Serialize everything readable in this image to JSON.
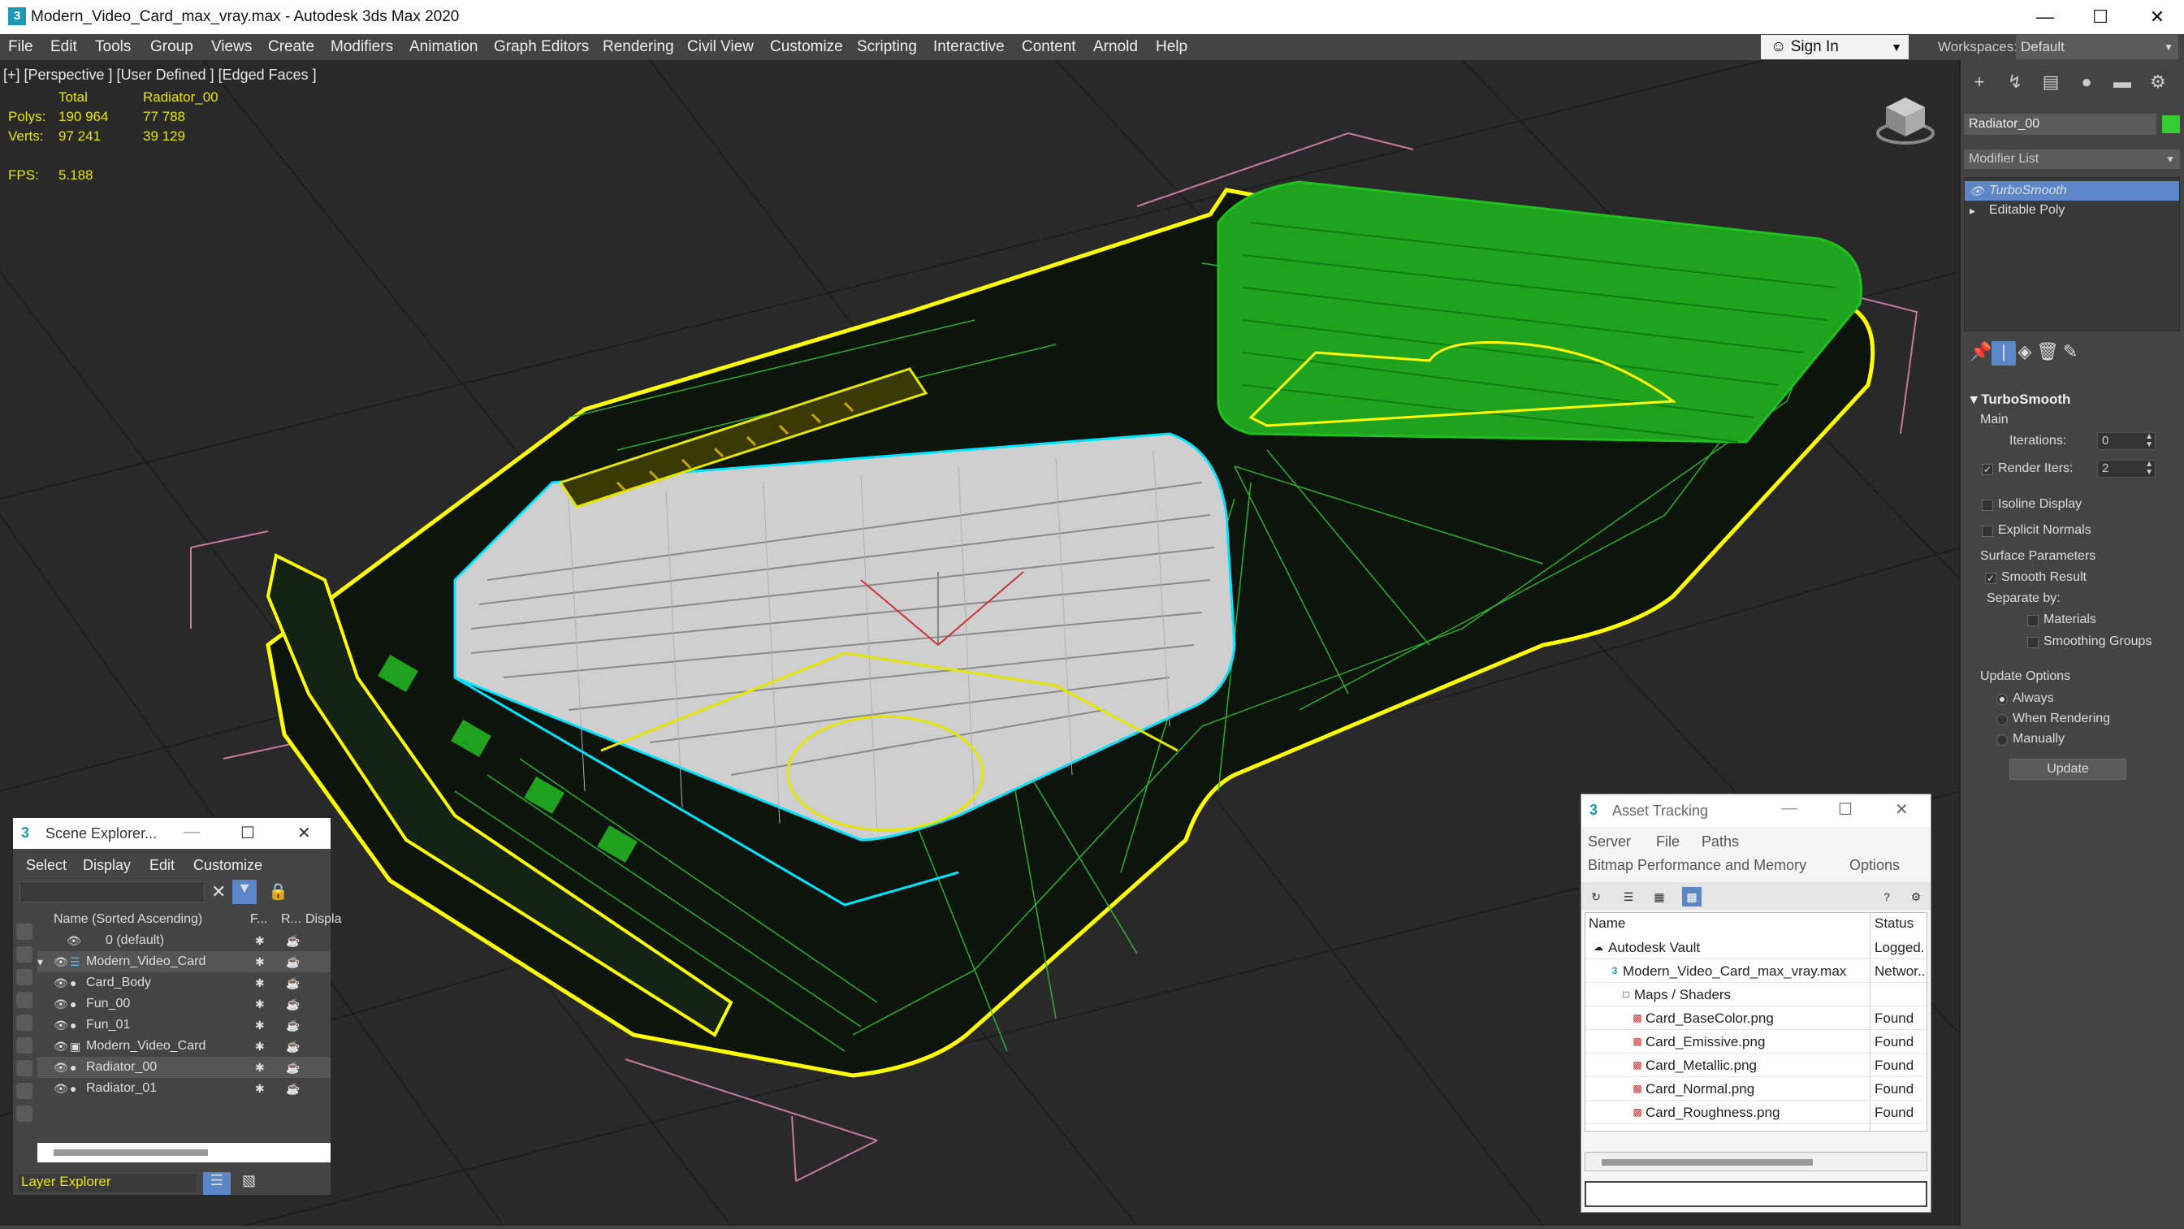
{
  "window": {
    "title": "Modern_Video_Card_max_vray.max - Autodesk 3ds Max 2020",
    "app_icon": "3"
  },
  "menu": [
    "File",
    "Edit",
    "Tools",
    "Group",
    "Views",
    "Create",
    "Modifiers",
    "Animation",
    "Graph Editors",
    "Rendering",
    "Civil View",
    "Customize",
    "Scripting",
    "Interactive",
    "Content",
    "Arnold",
    "Help"
  ],
  "account": {
    "sign_in": "Sign In"
  },
  "workspace": {
    "label": "Workspaces:",
    "value": "Default"
  },
  "viewport": {
    "label": "[+] [Perspective ] [User Defined ] [Edged Faces ]",
    "stats": {
      "header_total": "Total",
      "header_selected": "Radiator_00",
      "polys_label": "Polys:",
      "polys_total": "190 964",
      "polys_sel": "77 788",
      "verts_label": "Verts:",
      "verts_total": "97 241",
      "verts_sel": "39 129",
      "fps_label": "FPS:",
      "fps_value": "5.188"
    }
  },
  "command_panel": {
    "object_name": "Radiator_00",
    "object_color": "#33cc33",
    "modifier_list": "Modifier List",
    "stack": [
      "TurboSmooth",
      "Editable Poly"
    ],
    "rollout": {
      "title": "TurboSmooth",
      "main": "Main",
      "iterations_label": "Iterations:",
      "iterations_value": "0",
      "render_iters_label": "Render Iters:",
      "render_iters_value": "2",
      "isoline": "Isoline Display",
      "explicit_normals": "Explicit Normals",
      "surface_params": "Surface Parameters",
      "smooth_result": "Smooth Result",
      "separate_by": "Separate by:",
      "materials": "Materials",
      "smoothing_groups": "Smoothing Groups",
      "update_options": "Update Options",
      "always": "Always",
      "when_rendering": "When Rendering",
      "manually": "Manually",
      "update_button": "Update"
    }
  },
  "scene_explorer": {
    "title": "Scene Explorer...",
    "menu": [
      "Select",
      "Display",
      "Edit",
      "Customize"
    ],
    "columns": [
      "Name (Sorted Ascending)",
      "F...",
      "R...",
      "Displa"
    ],
    "rows": [
      "0 (default)",
      "Modern_Video_Card",
      "Card_Body",
      "Fun_00",
      "Fun_01",
      "Modern_Video_Card",
      "Radiator_00",
      "Radiator_01"
    ],
    "bottom_label": "Layer Explorer"
  },
  "asset_tracking": {
    "title": "Asset Tracking",
    "menu": [
      "Server",
      "File",
      "Paths"
    ],
    "menu2": [
      "Bitmap Performance and Memory",
      "Options"
    ],
    "columns": [
      "Name",
      "Status"
    ],
    "rows": [
      {
        "name": "Autodesk Vault",
        "status": "Logged."
      },
      {
        "name": "Modern_Video_Card_max_vray.max",
        "status": "Networ.."
      },
      {
        "name": "Maps / Shaders",
        "status": ""
      },
      {
        "name": "Card_BaseColor.png",
        "status": "Found"
      },
      {
        "name": "Card_Emissive.png",
        "status": "Found"
      },
      {
        "name": "Card_Metallic.png",
        "status": "Found"
      },
      {
        "name": "Card_Normal.png",
        "status": "Found"
      },
      {
        "name": "Card_Roughness.png",
        "status": "Found"
      }
    ]
  }
}
